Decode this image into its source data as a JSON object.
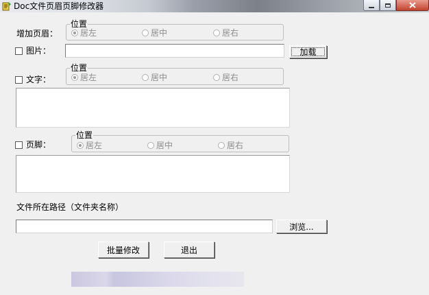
{
  "window": {
    "title": "Doc文件页眉页脚修改器",
    "accent_close": "#c2432d"
  },
  "header_section": {
    "label": "增加页眉：",
    "position_group_title": "位置",
    "options": [
      "居左",
      "居中",
      "居右"
    ],
    "selected": "居左"
  },
  "image_row": {
    "label": "图片：",
    "checked": false,
    "path_value": "",
    "load_button": "加载"
  },
  "text_section": {
    "label": "文字：",
    "checked": false,
    "position_group_title": "位置",
    "options": [
      "居左",
      "居中",
      "居右"
    ],
    "selected": "居左",
    "content": ""
  },
  "footer_section": {
    "label": "页脚：",
    "checked": false,
    "position_group_title": "位置",
    "options": [
      "居左",
      "居中",
      "居右"
    ],
    "selected": "居左",
    "content": ""
  },
  "path_section": {
    "label": "文件所在路径（文件夹名称）",
    "value": "",
    "browse_button": "浏览..."
  },
  "actions": {
    "batch_modify": "批量修改",
    "exit": "退出"
  }
}
